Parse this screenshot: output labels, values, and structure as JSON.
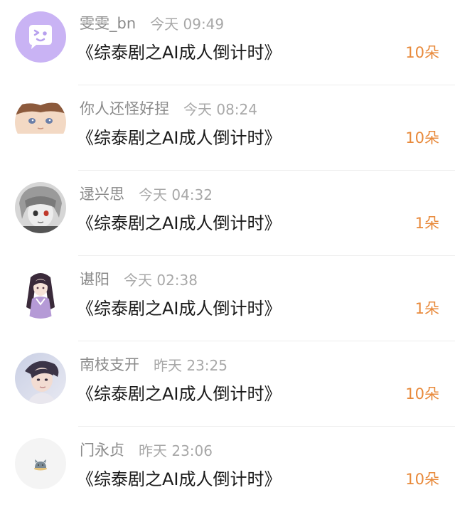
{
  "gifts": [
    {
      "username": "雯雯_bn",
      "time": "今天 09:49",
      "title": "《综泰剧之AI成人倒计时》",
      "count": "10朵",
      "avatar": "wink-face-avatar"
    },
    {
      "username": "你人还怪好捏",
      "time": "今天 08:24",
      "title": "《综泰剧之AI成人倒计时》",
      "count": "10朵",
      "avatar": "anime-boy-avatar"
    },
    {
      "username": "逯兴思",
      "time": "今天 04:32",
      "title": "《综泰剧之AI成人倒计时》",
      "count": "1朵",
      "avatar": "anime-grayscale-avatar"
    },
    {
      "username": "谌阳",
      "time": "今天 02:38",
      "title": "《综泰剧之AI成人倒计时》",
      "count": "1朵",
      "avatar": "anime-girl-avatar"
    },
    {
      "username": "南枝支开",
      "time": "昨天 23:25",
      "title": "《综泰剧之AI成人倒计时》",
      "count": "10朵",
      "avatar": "portrait-photo-avatar"
    },
    {
      "username": "门永贞",
      "time": "昨天 23:06",
      "title": "《综泰剧之AI成人倒计时》",
      "count": "10朵",
      "avatar": "default-cat-avatar"
    }
  ],
  "colors": {
    "count": "#e8893a",
    "username": "#8a8a8a",
    "time": "#a8a8a8",
    "title": "#1a1a1a",
    "divider": "#ededed"
  }
}
